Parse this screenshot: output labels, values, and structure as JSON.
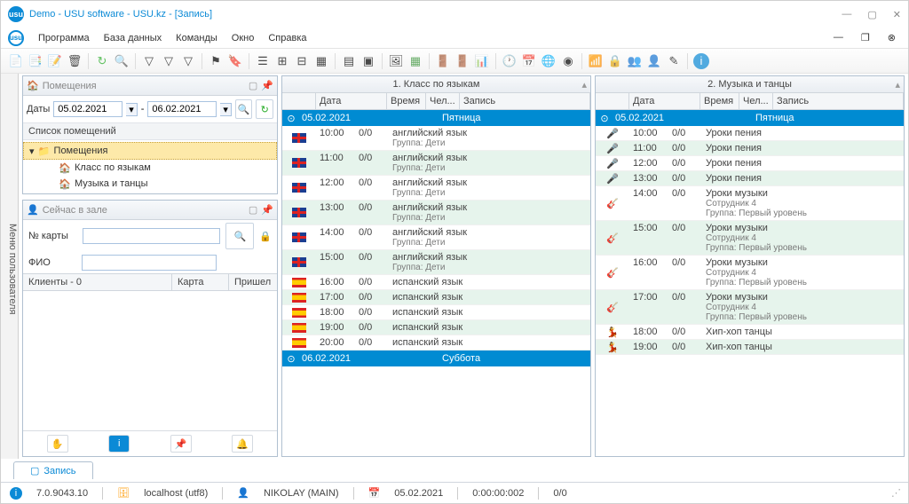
{
  "window": {
    "title": "Demo - USU software - USU.kz - [Запись]"
  },
  "menu": {
    "items": [
      "Программа",
      "База данных",
      "Команды",
      "Окно",
      "Справка"
    ]
  },
  "sidebar_tab": "Меню пользователя",
  "rooms_panel": {
    "title": "Помещения",
    "dates_label": "Даты",
    "date_from": "05.02.2021",
    "date_to": "06.02.2021",
    "list_header": "Список помещений",
    "root": "Помещения",
    "items": [
      "Класс по языкам",
      "Музыка и танцы"
    ]
  },
  "hall_panel": {
    "title": "Сейчас в зале",
    "card_label": "№ карты",
    "card_value": "",
    "fio_label": "ФИО",
    "fio_value": "",
    "clients_label": "Клиенты - 0",
    "card_col": "Карта",
    "arrived_col": "Пришел"
  },
  "sched1": {
    "title": "1. Класс по языкам",
    "cols": {
      "date": "Дата",
      "time": "Время",
      "ppl": "Чел...",
      "rec": "Запись"
    },
    "days": [
      {
        "date": "05.02.2021",
        "day": "Пятница",
        "rows": [
          {
            "icon": "gb",
            "time": "10:00",
            "ppl": "0/0",
            "r1": "английский язык",
            "r2": "Группа: Дети"
          },
          {
            "icon": "gb",
            "time": "11:00",
            "ppl": "0/0",
            "r1": "английский язык",
            "r2": "Группа: Дети"
          },
          {
            "icon": "gb",
            "time": "12:00",
            "ppl": "0/0",
            "r1": "английский язык",
            "r2": "Группа: Дети"
          },
          {
            "icon": "gb",
            "time": "13:00",
            "ppl": "0/0",
            "r1": "английский язык",
            "r2": "Группа: Дети"
          },
          {
            "icon": "gb",
            "time": "14:00",
            "ppl": "0/0",
            "r1": "английский язык",
            "r2": "Группа: Дети"
          },
          {
            "icon": "gb",
            "time": "15:00",
            "ppl": "0/0",
            "r1": "английский язык",
            "r2": "Группа: Дети"
          },
          {
            "icon": "es",
            "time": "16:00",
            "ppl": "0/0",
            "r1": "испанский язык",
            "r2": ""
          },
          {
            "icon": "es",
            "time": "17:00",
            "ppl": "0/0",
            "r1": "испанский язык",
            "r2": ""
          },
          {
            "icon": "es",
            "time": "18:00",
            "ppl": "0/0",
            "r1": "испанский язык",
            "r2": ""
          },
          {
            "icon": "es",
            "time": "19:00",
            "ppl": "0/0",
            "r1": "испанский язык",
            "r2": ""
          },
          {
            "icon": "es",
            "time": "20:00",
            "ppl": "0/0",
            "r1": "испанский язык",
            "r2": ""
          }
        ]
      },
      {
        "date": "06.02.2021",
        "day": "Суббота",
        "rows": []
      }
    ]
  },
  "sched2": {
    "title": "2. Музыка и танцы",
    "cols": {
      "date": "Дата",
      "time": "Время",
      "ppl": "Чел...",
      "rec": "Запись"
    },
    "days": [
      {
        "date": "05.02.2021",
        "day": "Пятница",
        "rows": [
          {
            "icon": "mic",
            "time": "10:00",
            "ppl": "0/0",
            "r1": "Уроки пения",
            "r2": ""
          },
          {
            "icon": "mic",
            "time": "11:00",
            "ppl": "0/0",
            "r1": "Уроки пения",
            "r2": ""
          },
          {
            "icon": "mic",
            "time": "12:00",
            "ppl": "0/0",
            "r1": "Уроки пения",
            "r2": ""
          },
          {
            "icon": "mic",
            "time": "13:00",
            "ppl": "0/0",
            "r1": "Уроки пения",
            "r2": ""
          },
          {
            "icon": "guitar",
            "time": "14:00",
            "ppl": "0/0",
            "r1": "Уроки музыки",
            "r2": "Сотрудник 4",
            "r3": "Группа: Первый уровень"
          },
          {
            "icon": "guitar",
            "time": "15:00",
            "ppl": "0/0",
            "r1": "Уроки музыки",
            "r2": "Сотрудник 4",
            "r3": "Группа: Первый уровень"
          },
          {
            "icon": "guitar",
            "time": "16:00",
            "ppl": "0/0",
            "r1": "Уроки музыки",
            "r2": "Сотрудник 4",
            "r3": "Группа: Первый уровень"
          },
          {
            "icon": "guitar",
            "time": "17:00",
            "ppl": "0/0",
            "r1": "Уроки музыки",
            "r2": "Сотрудник 4",
            "r3": "Группа: Первый уровень"
          },
          {
            "icon": "dance",
            "time": "18:00",
            "ppl": "0/0",
            "r1": "Хип-хоп танцы",
            "r2": ""
          },
          {
            "icon": "dance",
            "time": "19:00",
            "ppl": "0/0",
            "r1": "Хип-хоп танцы",
            "r2": ""
          }
        ]
      }
    ]
  },
  "bottom_tab": "Запись",
  "status": {
    "version": "7.0.9043.10",
    "host": "localhost (utf8)",
    "user": "NIKOLAY (MAIN)",
    "date": "05.02.2021",
    "time": "0:00:00:002",
    "count": "0/0"
  }
}
